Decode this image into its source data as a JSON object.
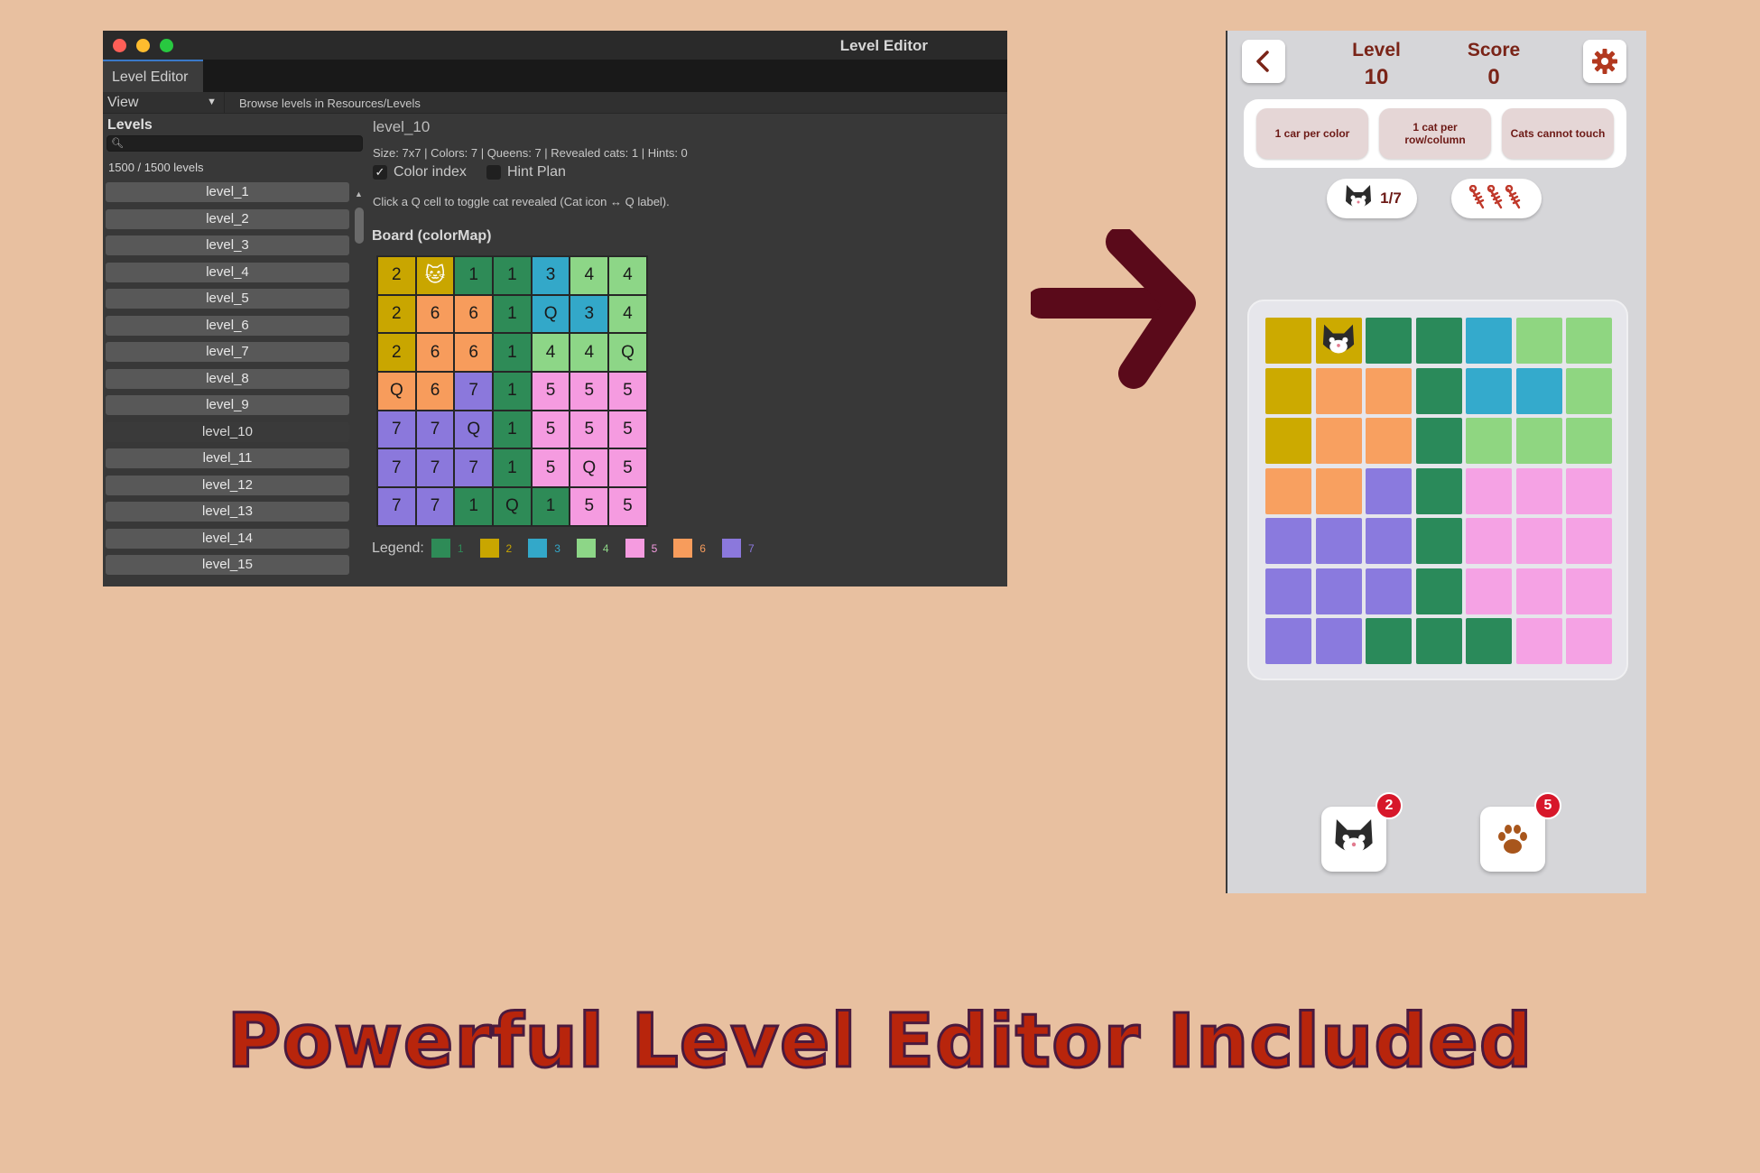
{
  "editor": {
    "window_title": "Level Editor",
    "tab_label": "Level Editor",
    "view_label": "View",
    "browse_label": "Browse levels in Resources/Levels",
    "levels_title": "Levels",
    "search_icon": "search-icon",
    "levels_count": "1500 / 1500 levels",
    "levels": [
      "level_1",
      "level_2",
      "level_3",
      "level_4",
      "level_5",
      "level_6",
      "level_7",
      "level_8",
      "level_9",
      "level_10",
      "level_11",
      "level_12",
      "level_13",
      "level_14",
      "level_15"
    ],
    "selected_level": "level_10",
    "level_name": "level_10",
    "stats": "Size: 7x7  |  Colors: 7  |  Queens: 7  |  Revealed cats: 1  |  Hints: 0",
    "color_index_label": "Color index",
    "color_index_checked": true,
    "hint_plan_label": "Hint Plan",
    "hint_plan_checked": false,
    "hint_text": "Click a Q cell to toggle cat revealed (Cat icon ↔ Q label).",
    "board_title": "Board (colorMap)",
    "board": [
      [
        "2",
        "cat",
        "1",
        "1",
        "3",
        "4",
        "4"
      ],
      [
        "2",
        "6",
        "6",
        "1",
        "Q",
        "3",
        "4"
      ],
      [
        "2",
        "6",
        "6",
        "1",
        "4",
        "4",
        "Q"
      ],
      [
        "Q",
        "6",
        "7",
        "1",
        "5",
        "5",
        "5"
      ],
      [
        "7",
        "7",
        "Q",
        "1",
        "5",
        "5",
        "5"
      ],
      [
        "7",
        "7",
        "7",
        "1",
        "5",
        "Q",
        "5"
      ],
      [
        "7",
        "7",
        "1",
        "Q",
        "1",
        "5",
        "5"
      ]
    ],
    "board_colors": [
      [
        2,
        2,
        1,
        1,
        3,
        4,
        4
      ],
      [
        2,
        6,
        6,
        1,
        3,
        3,
        4
      ],
      [
        2,
        6,
        6,
        1,
        4,
        4,
        4
      ],
      [
        6,
        6,
        7,
        1,
        5,
        5,
        5
      ],
      [
        7,
        7,
        7,
        1,
        5,
        5,
        5
      ],
      [
        7,
        7,
        7,
        1,
        5,
        5,
        5
      ],
      [
        7,
        7,
        1,
        1,
        1,
        5,
        5
      ]
    ],
    "legend_label": "Legend:",
    "legend": [
      {
        "label": "1",
        "color": "#2e8b57"
      },
      {
        "label": "2",
        "color": "#c9a600"
      },
      {
        "label": "3",
        "color": "#33a8c9"
      },
      {
        "label": "4",
        "color": "#8dd687"
      },
      {
        "label": "5",
        "color": "#f59be0"
      },
      {
        "label": "6",
        "color": "#f79c5c"
      },
      {
        "label": "7",
        "color": "#8b78dc"
      }
    ]
  },
  "game": {
    "back_icon": "chevron-left-icon",
    "level_label": "Level",
    "level_value": "10",
    "score_label": "Score",
    "score_value": "0",
    "settings_icon": "gear-icon",
    "rules": [
      "1 car per color",
      "1 cat per row/column",
      "Cats cannot touch"
    ],
    "cats_found": "1/7",
    "fish_icon": "fish-bone-icon",
    "grid": [
      [
        2,
        2,
        1,
        1,
        3,
        4,
        4
      ],
      [
        2,
        6,
        6,
        1,
        3,
        3,
        4
      ],
      [
        2,
        6,
        6,
        1,
        4,
        4,
        4
      ],
      [
        6,
        6,
        7,
        1,
        5,
        5,
        5
      ],
      [
        7,
        7,
        7,
        1,
        5,
        5,
        5
      ],
      [
        7,
        7,
        7,
        1,
        5,
        5,
        5
      ],
      [
        7,
        7,
        1,
        1,
        1,
        5,
        5
      ]
    ],
    "cat_position": [
      0,
      1
    ],
    "colors": {
      "1": "#2a8a5a",
      "2": "#ccaa00",
      "3": "#34aacc",
      "4": "#8fd681",
      "5": "#f5a2e4",
      "6": "#f8a060",
      "7": "#8a7ade"
    },
    "cat_hint_badge": "2",
    "paw_hint_badge": "5"
  },
  "headline": "Powerful Level Editor Included",
  "accent_arrow_color": "#5a0a1a"
}
